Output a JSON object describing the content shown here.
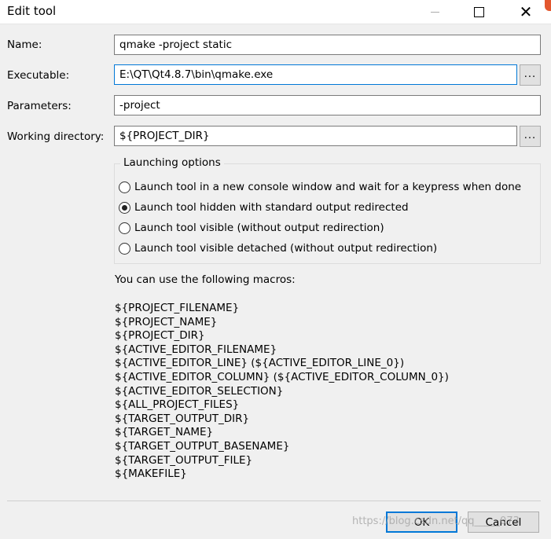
{
  "window": {
    "title": "Edit tool",
    "close_glyph": "✕"
  },
  "form": {
    "name_label": "Name:",
    "name_value": "qmake -project static",
    "executable_label": "Executable:",
    "executable_value": "E:\\QT\\Qt4.8.7\\bin\\qmake.exe",
    "parameters_label": "Parameters:",
    "parameters_value": "-project",
    "working_dir_label": "Working directory:",
    "working_dir_value": "${PROJECT_DIR}",
    "browse_label": "..."
  },
  "launching": {
    "title": "Launching options",
    "options": [
      {
        "label": "Launch tool in a new console window and wait for a keypress when done",
        "checked": false
      },
      {
        "label": "Launch tool hidden with standard output redirected",
        "checked": true
      },
      {
        "label": "Launch tool visible (without output redirection)",
        "checked": false
      },
      {
        "label": "Launch tool visible detached (without output redirection)",
        "checked": false
      }
    ]
  },
  "macros": {
    "intro": "You can use the following macros:",
    "items": [
      "${PROJECT_FILENAME}",
      "${PROJECT_NAME}",
      "${PROJECT_DIR}",
      "${ACTIVE_EDITOR_FILENAME}",
      "${ACTIVE_EDITOR_LINE} (${ACTIVE_EDITOR_LINE_0})",
      "${ACTIVE_EDITOR_COLUMN} (${ACTIVE_EDITOR_COLUMN_0})",
      "${ACTIVE_EDITOR_SELECTION}",
      "${ALL_PROJECT_FILES}",
      "${TARGET_OUTPUT_DIR}",
      "${TARGET_NAME}",
      "${TARGET_OUTPUT_BASENAME}",
      "${TARGET_OUTPUT_FILE}",
      "${MAKEFILE}"
    ]
  },
  "buttons": {
    "ok": "OK",
    "cancel": "Cancel"
  },
  "watermark": "https://blog.csdn.net/qq_____073"
}
